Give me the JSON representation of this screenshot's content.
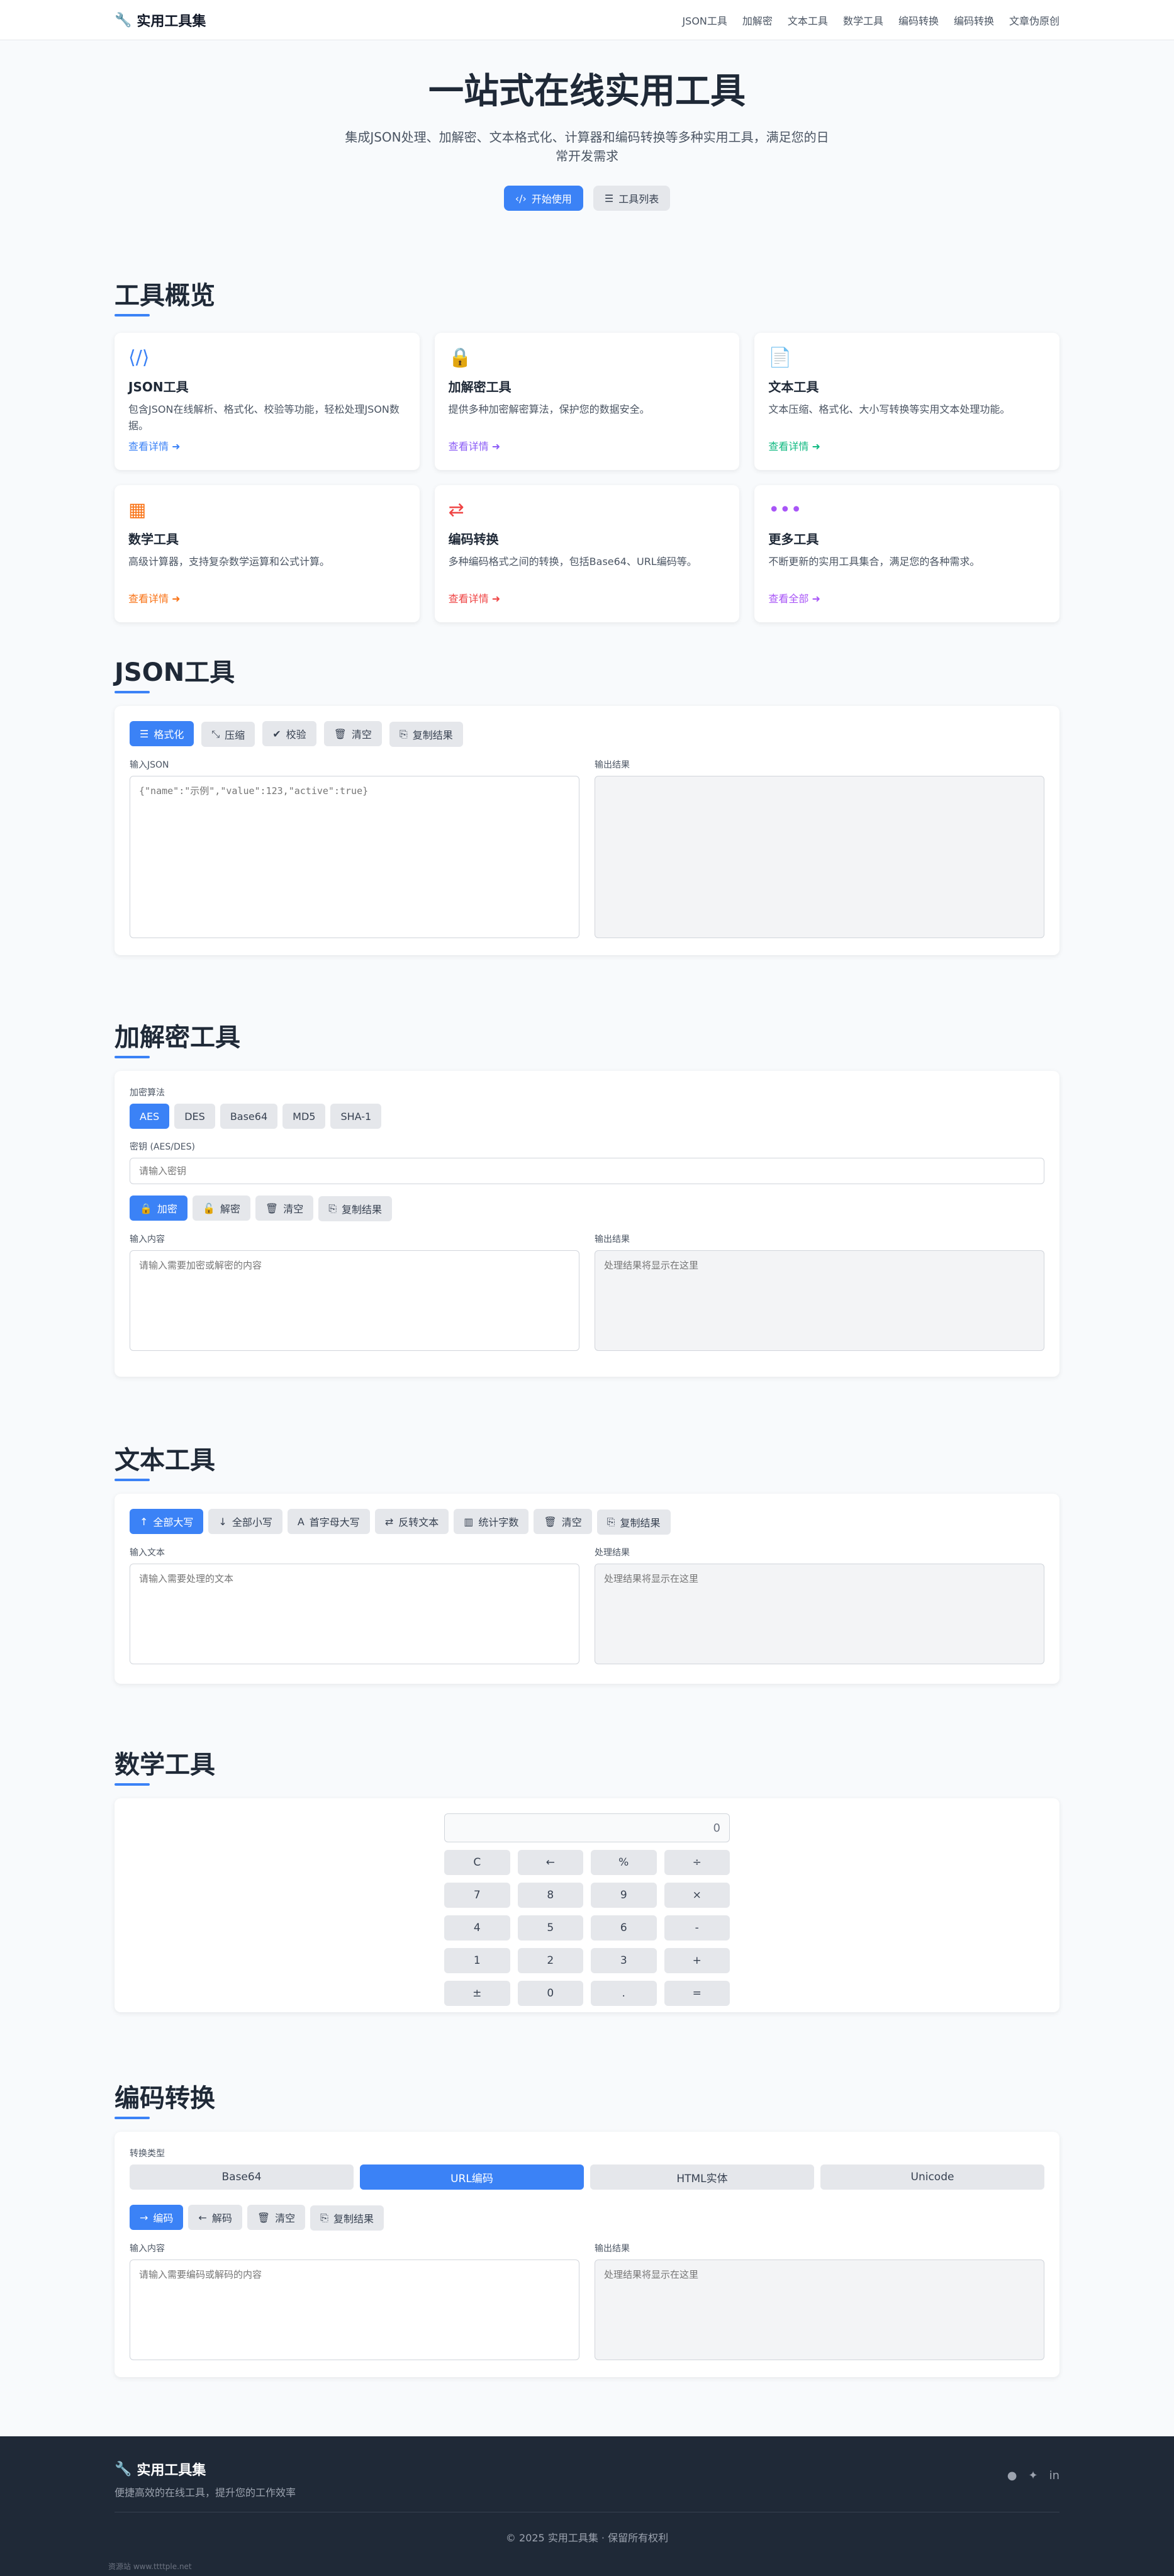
{
  "nav": {
    "logo": "实用工具集",
    "links": [
      "JSON工具",
      "加解密",
      "文本工具",
      "数学工具",
      "编码转换",
      "编码转换",
      "文章伪原创"
    ]
  },
  "hero": {
    "title": "一站式在线实用工具",
    "subtitle": "集成JSON处理、加解密、文本格式化、计算器和编码转换等多种实用工具，满足您的日常开发需求",
    "btn_start": "开始使用",
    "btn_list": "工具列表"
  },
  "overview": {
    "title": "工具概览",
    "cards": [
      {
        "icon": "code-file-icon",
        "glyph": "⟨/⟩",
        "color": "#3b82f6",
        "title": "JSON工具",
        "desc": "包含JSON在线解析、格式化、校验等功能，轻松处理JSON数据。",
        "link": "查看详情"
      },
      {
        "icon": "lock-icon",
        "glyph": "🔒",
        "color": "#8b5cf6",
        "title": "加解密工具",
        "desc": "提供多种加密解密算法，保护您的数据安全。",
        "link": "查看详情"
      },
      {
        "icon": "text-file-icon",
        "glyph": "📄",
        "color": "#10b981",
        "title": "文本工具",
        "desc": "文本压缩、格式化、大小写转换等实用文本处理功能。",
        "link": "查看详情"
      },
      {
        "icon": "calculator-icon",
        "glyph": "▦",
        "color": "#f97316",
        "title": "数学工具",
        "desc": "高级计算器，支持复杂数学运算和公式计算。",
        "link": "查看详情"
      },
      {
        "icon": "exchange-icon",
        "glyph": "⇄",
        "color": "#ef4444",
        "title": "编码转换",
        "desc": "多种编码格式之间的转换，包括Base64、URL编码等。",
        "link": "查看详情"
      },
      {
        "icon": "more-icon",
        "glyph": "•••",
        "color": "#a855f7",
        "title": "更多工具",
        "desc": "不断更新的实用工具集合，满足您的各种需求。",
        "link": "查看全部"
      }
    ]
  },
  "json_tool": {
    "title": "JSON工具",
    "buttons": [
      "格式化",
      "压缩",
      "校验",
      "清空",
      "复制结果"
    ],
    "input_label": "输入JSON",
    "input_placeholder": "{\"name\":\"示例\",\"value\":123,\"active\":true}",
    "output_label": "输出结果"
  },
  "crypto_tool": {
    "title": "加解密工具",
    "algo_label": "加密算法",
    "algos": [
      "AES",
      "DES",
      "Base64",
      "MD5",
      "SHA-1"
    ],
    "key_label": "密钥 (AES/DES)",
    "key_placeholder": "请输入密钥",
    "buttons": [
      "加密",
      "解密",
      "清空",
      "复制结果"
    ],
    "input_label": "输入内容",
    "input_placeholder": "请输入需要加密或解密的内容",
    "output_label": "输出结果",
    "output_placeholder": "处理结果将显示在这里"
  },
  "text_tool": {
    "title": "文本工具",
    "buttons": [
      "全部大写",
      "全部小写",
      "首字母大写",
      "反转文本",
      "统计字数",
      "清空",
      "复制结果"
    ],
    "input_label": "输入文本",
    "input_placeholder": "请输入需要处理的文本",
    "output_label": "处理结果",
    "output_placeholder": "处理结果将显示在这里"
  },
  "math_tool": {
    "title": "数学工具",
    "display": "0",
    "keys": [
      "C",
      "←",
      "%",
      "÷",
      "7",
      "8",
      "9",
      "×",
      "4",
      "5",
      "6",
      "-",
      "1",
      "2",
      "3",
      "+",
      "±",
      "0",
      ".",
      "="
    ]
  },
  "encode_tool": {
    "title": "编码转换",
    "type_label": "转换类型",
    "types": [
      "Base64",
      "URL编码",
      "HTML实体",
      "Unicode"
    ],
    "buttons": [
      "编码",
      "解码",
      "清空",
      "复制结果"
    ],
    "input_label": "输入内容",
    "input_placeholder": "请输入需要编码或解码的内容",
    "output_label": "输出结果",
    "output_placeholder": "处理结果将显示在这里"
  },
  "footer": {
    "logo": "实用工具集",
    "subtitle": "便捷高效的在线工具，提升您的工作效率",
    "copyright": "© 2025 实用工具集 · 保留所有权利",
    "footnote": "资源站 www.ttttple.net"
  }
}
